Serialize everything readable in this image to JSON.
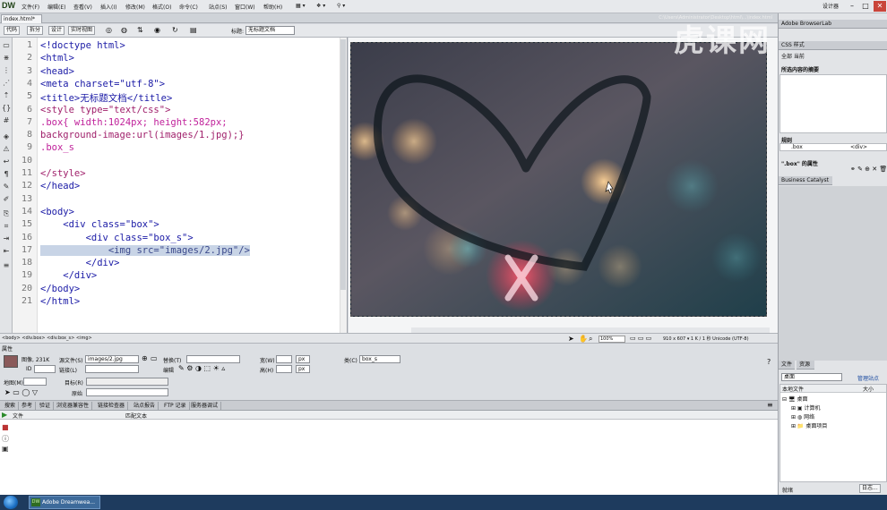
{
  "app": {
    "logo": "DW",
    "menu": [
      "文件(F)",
      "编辑(E)",
      "查看(V)",
      "插入(I)",
      "修改(M)",
      "格式(O)",
      "命令(C)",
      "站点(S)",
      "窗口(W)",
      "帮助(H)"
    ],
    "layout_button": "设计器",
    "window_buttons": [
      "–",
      "□",
      "✕"
    ]
  },
  "tabbar": {
    "doc_tab": "index.html*",
    "file_path": "C:\\Users\\Administrator\\Desktop\\html\\...\\index.html"
  },
  "doc_toolbar": {
    "views": [
      "代码",
      "拆分",
      "设计",
      "实时视图"
    ],
    "title_label": "标题:",
    "title_value": "无标题文档"
  },
  "code": {
    "line_numbers": [
      "1",
      "2",
      "3",
      "4",
      "5",
      "6",
      "7",
      "8",
      "9",
      "10",
      "11",
      "12",
      "13",
      "14",
      "15",
      "16",
      "17",
      "18",
      "19",
      "20",
      "21"
    ],
    "lines": [
      "<!doctype html>",
      "<html>",
      "<head>",
      "<meta charset=\"utf-8\">",
      "<title>无标题文档</title>",
      "<style type=\"text/css\">",
      ".box{ width:1024px; height:582px;",
      "background-image:url(images/1.jpg);}",
      ".box_s",
      "",
      "</style>",
      "</head>",
      "",
      "<body>",
      "    <div class=\"box\">",
      "        <div class=\"box_s\">",
      "            <img src=\"images/2.jpg\"/>",
      "        </div>",
      "    </div>",
      "</body>",
      "</html>"
    ]
  },
  "statusbar": {
    "tag_path": "<body> <div.box> <div.box_s> <img>",
    "zoom": "100%",
    "dims": "910 x 607 ▾ 1 K / 1 秒 Unicode (UTF-8)"
  },
  "properties": {
    "title": "属性",
    "image_label": "图像, 231K",
    "id_label": "ID",
    "src_label": "源文件(S)",
    "src_value": "images/2.jpg",
    "link_label": "链接(L)",
    "edit_label": "编辑",
    "alt_label": "替换(T)",
    "width_label": "宽(W)",
    "height_label": "高(H)",
    "unit": "px",
    "class_label": "类(C)",
    "class_value": "box_s",
    "map_label": "地图(M)",
    "target_label": "目标(R)",
    "original_label": "原始"
  },
  "results": {
    "tabs": [
      "搜索",
      "参考",
      "验证",
      "浏览器兼容性",
      "链接检查器",
      "站点报告",
      "FTP 记录",
      "服务器调试"
    ],
    "col_file": "文件",
    "col_match": "匹配文本"
  },
  "right_panel": {
    "top_tabs": "Adobe BrowserLab",
    "css_tab": "CSS 样式",
    "css_sub": "全部 当前",
    "summary_title": "所选内容的摘要",
    "rules_label": "规则",
    "rule_row_left": ".box",
    "rule_row_right": "<div>",
    "props_label": "\".box\" 的属性",
    "bc_tab": "Business Catalyst",
    "files_tabs": [
      "文件",
      "资源"
    ],
    "files_select": "桌面",
    "files_manage": "管理站点",
    "local_files": "本地文件",
    "size_col": "大小",
    "tree": [
      "桌面",
      "计算机",
      "网络",
      "桌面项目"
    ],
    "log_button": "日志...",
    "status_label": "就绪"
  },
  "taskbar": {
    "app_label": "Adobe Dreamwea..."
  },
  "watermark": "虎课网"
}
